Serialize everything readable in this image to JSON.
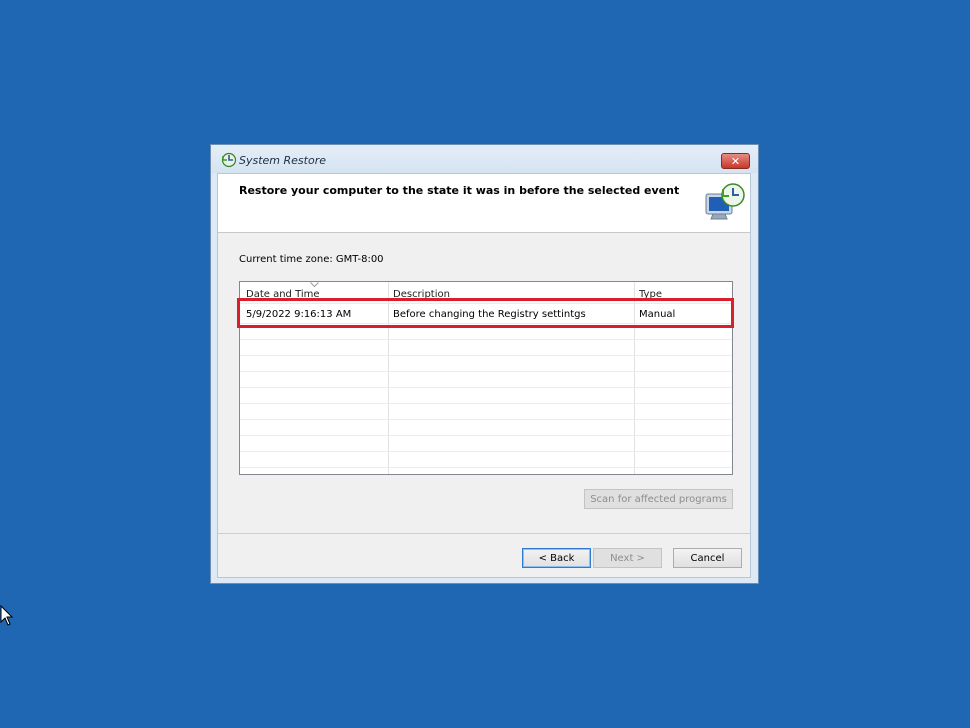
{
  "window": {
    "title": "System Restore",
    "close_label": "✕"
  },
  "header": {
    "heading": "Restore your computer to the state it was in before the selected event"
  },
  "timezone_label": "Current time zone: GMT-8:00",
  "table": {
    "columns": [
      "Date and Time",
      "Description",
      "Type"
    ],
    "rows": [
      [
        "5/9/2022 9:16:13 AM",
        "Before changing the Registry settintgs",
        "Manual"
      ]
    ]
  },
  "buttons": {
    "scan": "Scan for affected programs",
    "back": "< Back",
    "next": "Next >",
    "cancel": "Cancel"
  },
  "icons": {
    "title": "system-restore-icon",
    "header": "restore-computer-icon",
    "cursor": "mouse-pointer-icon"
  },
  "colors": {
    "desktop": "#1f66b3",
    "highlight": "#d8202c"
  }
}
